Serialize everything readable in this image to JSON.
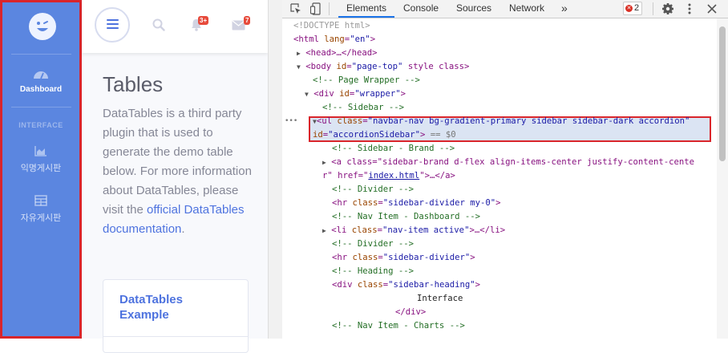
{
  "sidebar": {
    "brand_icon": "laugh-wink-icon",
    "items": [
      {
        "label": "Dashboard",
        "icon": "tachometer-icon"
      },
      {
        "label": "익명게시판",
        "icon": "chart-area-icon"
      },
      {
        "label": "자유게시판",
        "icon": "table-icon"
      }
    ],
    "heading": "INTERFACE",
    "colors": {
      "background": "#5b86e0",
      "highlight_border": "#d9252b"
    }
  },
  "topbar": {
    "alerts_count": "3+",
    "messages_count": "7"
  },
  "page": {
    "title": "Tables",
    "description_pre": "DataTables is a third party plugin that is used to generate the demo table below. For more information about DataTables, please visit the ",
    "link_text": "official DataTables documentation",
    "description_post": ".",
    "card_title": "DataTables Example"
  },
  "devtools": {
    "tabs": [
      "Elements",
      "Console",
      "Sources",
      "Network"
    ],
    "active_tab": "Elements",
    "more": "»",
    "error_count": "2",
    "ellipsis": "•••",
    "lines": {
      "l1": "<!DOCTYPE html>",
      "l2_open": "<html lang=\"en\">",
      "l3": "<head>…</head>",
      "l4": "<body id=\"page-top\" style class>",
      "l5": "<!-- Page Wrapper -->",
      "l6": "<div id=\"wrapper\">",
      "l7": "<!-- Sidebar -->",
      "l8": "<ul class=\"navbar-nav bg-gradient-primary sidebar sidebar-dark accordion\"",
      "l9": "id=\"accordionSidebar\"> == $0",
      "l10": "<!-- Sidebar - Brand -->",
      "l11a": "<a class=\"sidebar-brand d-flex align-items-center justify-content-cente",
      "l11b_pre": "r\" href=\"",
      "l11b_link": "index.html",
      "l11b_post": "\">…</a>",
      "l12": "<!-- Divider -->",
      "l13": "<hr class=\"sidebar-divider my-0\">",
      "l14": "<!-- Nav Item - Dashboard -->",
      "l15": "<li class=\"nav-item active\">…</li>",
      "l16": "<!-- Divider -->",
      "l17": "<hr class=\"sidebar-divider\">",
      "l18": "<!-- Heading -->",
      "l19": "<div class=\"sidebar-heading\">",
      "l20": "Interface",
      "l21": "</div>",
      "l22": "<!-- Nav Item - Charts -->"
    }
  }
}
